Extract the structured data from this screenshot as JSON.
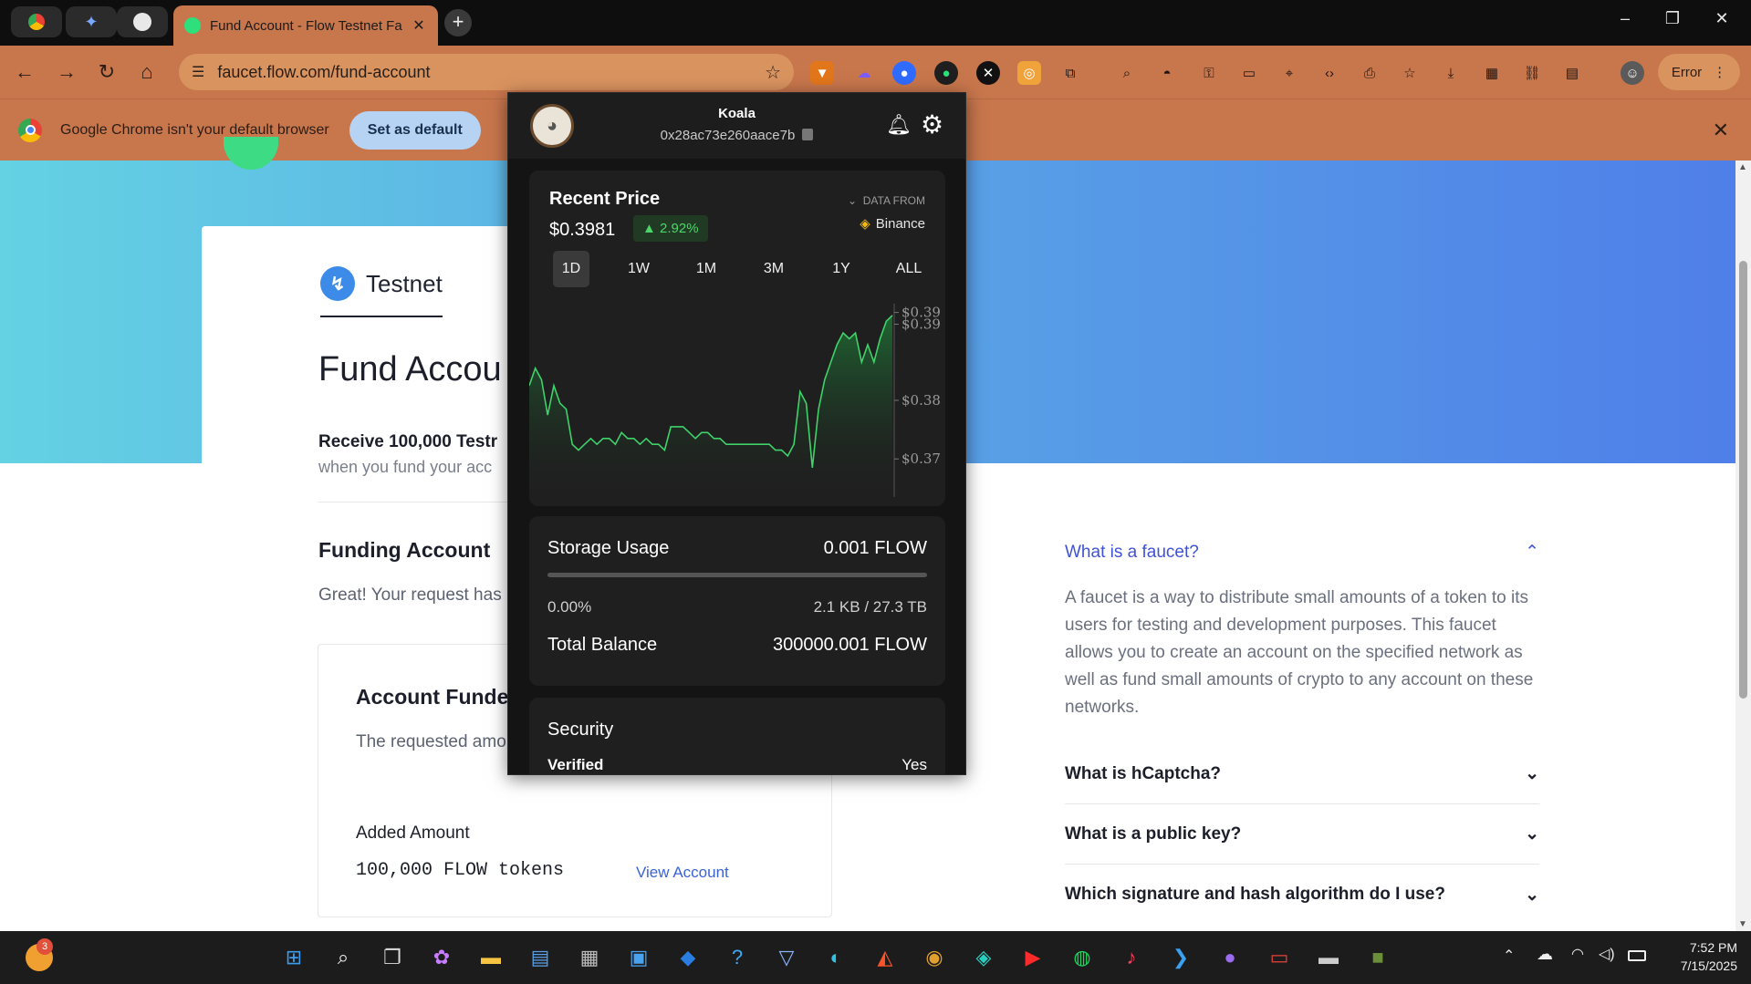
{
  "browser": {
    "tab_title": "Fund Account - Flow Testnet Fa",
    "url": "faucet.flow.com/fund-account",
    "profile_label": "Error",
    "window_controls": {
      "minimize": "–",
      "restore": "❐",
      "close": "✕"
    }
  },
  "infobar": {
    "message": "Google Chrome isn't your default browser",
    "button": "Set as default"
  },
  "page": {
    "network_tab": "Testnet",
    "title": "Fund Accou",
    "receive_bold": "Receive 100,000 Testr",
    "receive_sub": "when you fund your acc",
    "funding_heading": "Funding Account",
    "great_text": "Great! Your request has",
    "funded_heading": "Account Funde",
    "requested_text": "The requested amo testnet account!",
    "added_amount_label": "Added Amount",
    "added_amount_value": "100,000 FLOW tokens",
    "view_account": "View Account"
  },
  "faq": {
    "open_question": "What is a faucet?",
    "open_answer": "A faucet is a way to distribute small amounts of a token to its users for testing and development purposes. This faucet allows you to create an account on the specified network as well as fund small amounts of crypto to any account on these networks.",
    "q2": "What is hCaptcha?",
    "q3": "What is a public key?",
    "q4": "Which signature and hash algorithm do I use?"
  },
  "wallet": {
    "name": "Koala",
    "address": "0x28ac73e260aace7b",
    "recent_price": {
      "title": "Recent Price",
      "value": "$0.3981",
      "change": "2.92%",
      "data_from": "DATA FROM",
      "source": "Binance",
      "ranges": [
        "1D",
        "1W",
        "1M",
        "3M",
        "1Y",
        "ALL"
      ],
      "selected_range": "1D"
    },
    "storage": {
      "label": "Storage Usage",
      "value": "0.001 FLOW",
      "percent": "0.00%",
      "usage": "2.1 KB / 27.3 TB",
      "balance_label": "Total Balance",
      "balance_value": "300000.001 FLOW"
    },
    "security": {
      "title": "Security",
      "verified_label": "Verified",
      "verified_value": "Yes"
    }
  },
  "chart_data": {
    "type": "area",
    "title": "",
    "xlabel": "",
    "ylabel": "",
    "y_tick_labels": [
      "$0.39",
      "$0.39",
      "$0.38",
      "$0.37"
    ],
    "y_ticks": [
      0.3975,
      0.3955,
      0.3825,
      0.3725
    ],
    "ylim": [
      0.366,
      0.399
    ],
    "x": [
      0,
      1,
      2,
      3,
      4,
      5,
      6,
      7,
      8,
      9,
      10,
      11,
      12,
      13,
      14,
      15,
      16,
      17,
      18,
      19,
      20,
      21,
      22,
      23,
      24,
      25,
      26,
      27,
      28,
      29,
      30,
      31,
      32,
      33,
      34,
      35,
      36,
      37,
      38,
      39,
      40,
      41,
      42,
      43,
      44,
      45,
      46,
      47,
      48,
      49,
      50,
      51,
      52,
      53,
      54,
      55,
      56,
      57,
      58,
      59
    ],
    "series": [
      {
        "values": [
          0.385,
          0.388,
          0.386,
          0.38,
          0.385,
          0.382,
          0.381,
          0.375,
          0.374,
          0.375,
          0.376,
          0.375,
          0.376,
          0.376,
          0.375,
          0.377,
          0.376,
          0.376,
          0.375,
          0.376,
          0.375,
          0.375,
          0.374,
          0.378,
          0.378,
          0.378,
          0.377,
          0.376,
          0.377,
          0.377,
          0.376,
          0.376,
          0.375,
          0.375,
          0.375,
          0.375,
          0.375,
          0.375,
          0.375,
          0.375,
          0.374,
          0.374,
          0.373,
          0.375,
          0.384,
          0.382,
          0.371,
          0.381,
          0.386,
          0.389,
          0.392,
          0.394,
          0.393,
          0.394,
          0.389,
          0.392,
          0.389,
          0.393,
          0.396,
          0.397
        ]
      }
    ],
    "grid": false,
    "legend": "none",
    "colors": {
      "line": "#3fd26a",
      "fill_top": "#1f6b33",
      "fill_bottom": "#1f1f1f"
    }
  },
  "taskbar": {
    "time": "7:52 PM",
    "date": "7/15/2025",
    "notif_count": "3"
  }
}
